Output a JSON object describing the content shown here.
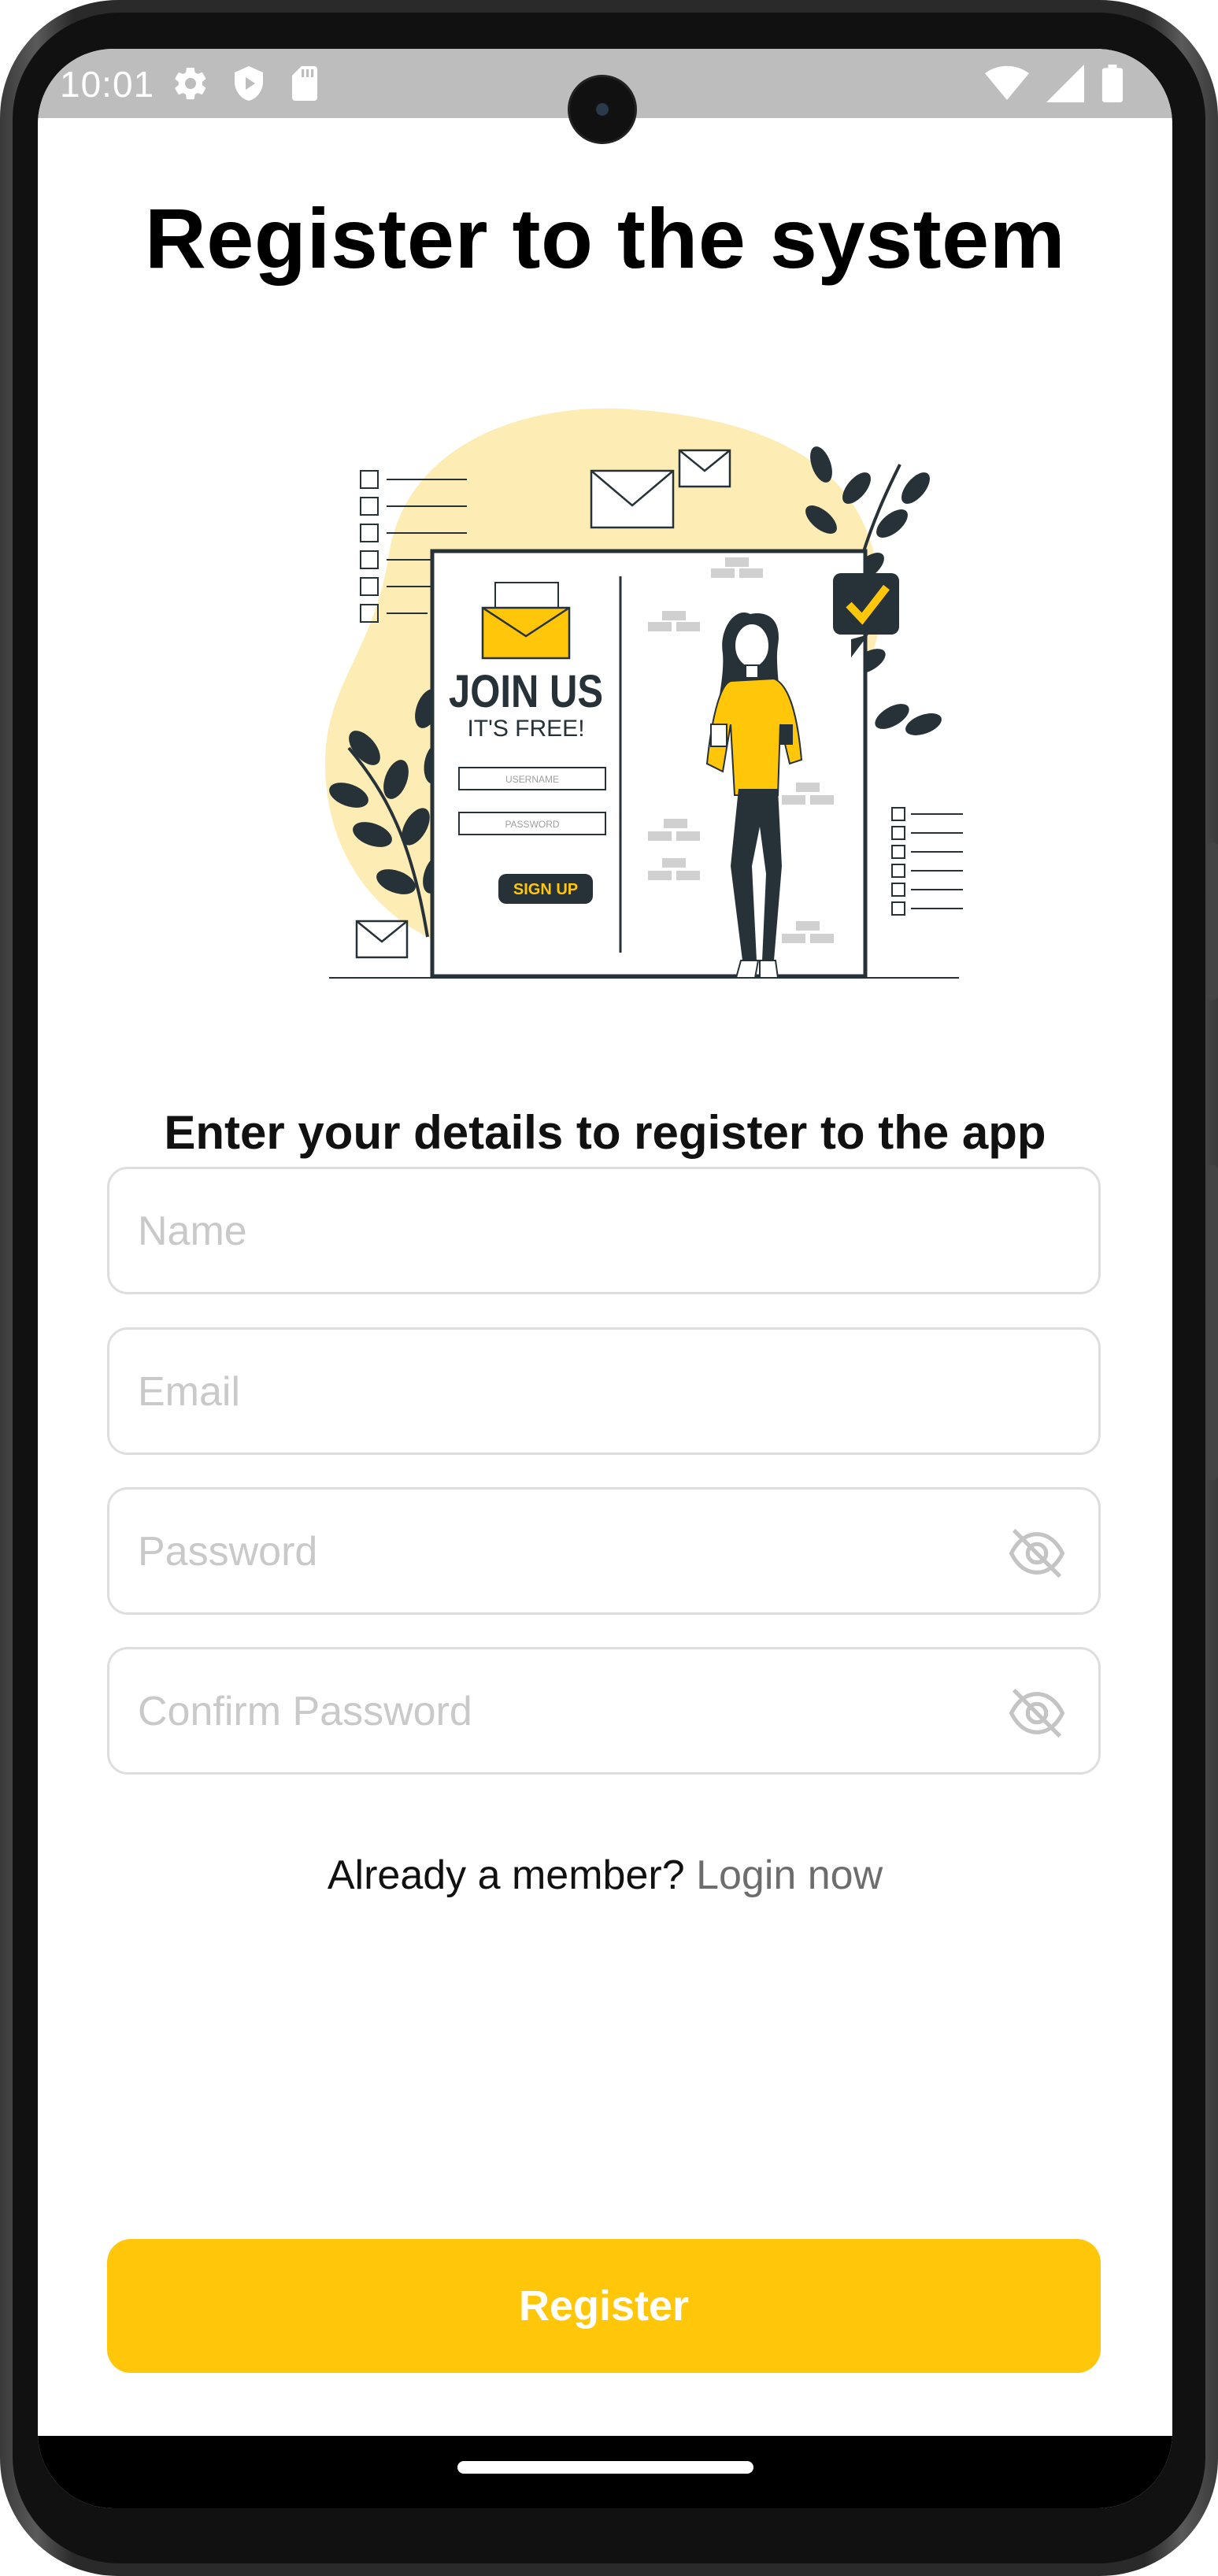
{
  "status_bar": {
    "time": "10:01",
    "left_icons": [
      "gear-icon",
      "shield-play-icon",
      "sd-card-icon"
    ],
    "right_icons": [
      "wifi-icon",
      "signal-icon",
      "battery-icon"
    ]
  },
  "page": {
    "title": "Register to the system",
    "subtitle": "Enter your details to register to the app"
  },
  "illustration": {
    "heading": "JOIN US",
    "tagline": "IT'S FREE!",
    "username_label": "USERNAME",
    "password_label": "PASSWORD",
    "button_label": "SIGN UP",
    "accent_color": "#ffc60a",
    "blob_color": "#fdedb5",
    "ink_color": "#263238"
  },
  "form": {
    "name_placeholder": "Name",
    "email_placeholder": "Email",
    "password_placeholder": "Password",
    "confirm_password_placeholder": "Confirm Password",
    "toggle_icon": "eye-off-icon"
  },
  "login_prompt": {
    "text": "Already a member? ",
    "link": "Login now"
  },
  "register_button": {
    "label": "Register",
    "color": "#ffc60a"
  }
}
